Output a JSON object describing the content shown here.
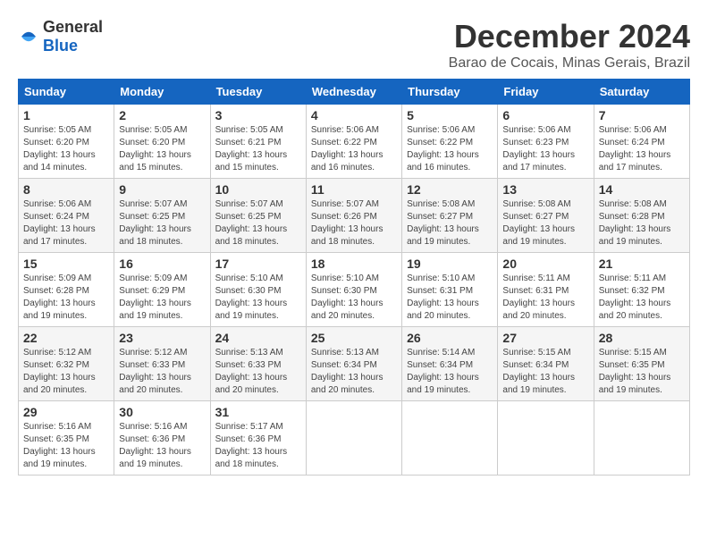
{
  "header": {
    "logo_general": "General",
    "logo_blue": "Blue",
    "month": "December 2024",
    "location": "Barao de Cocais, Minas Gerais, Brazil"
  },
  "days_of_week": [
    "Sunday",
    "Monday",
    "Tuesday",
    "Wednesday",
    "Thursday",
    "Friday",
    "Saturday"
  ],
  "weeks": [
    [
      {
        "day": "1",
        "sunrise": "5:05 AM",
        "sunset": "6:20 PM",
        "daylight": "13 hours and 14 minutes."
      },
      {
        "day": "2",
        "sunrise": "5:05 AM",
        "sunset": "6:20 PM",
        "daylight": "13 hours and 15 minutes."
      },
      {
        "day": "3",
        "sunrise": "5:05 AM",
        "sunset": "6:21 PM",
        "daylight": "13 hours and 15 minutes."
      },
      {
        "day": "4",
        "sunrise": "5:06 AM",
        "sunset": "6:22 PM",
        "daylight": "13 hours and 16 minutes."
      },
      {
        "day": "5",
        "sunrise": "5:06 AM",
        "sunset": "6:22 PM",
        "daylight": "13 hours and 16 minutes."
      },
      {
        "day": "6",
        "sunrise": "5:06 AM",
        "sunset": "6:23 PM",
        "daylight": "13 hours and 17 minutes."
      },
      {
        "day": "7",
        "sunrise": "5:06 AM",
        "sunset": "6:24 PM",
        "daylight": "13 hours and 17 minutes."
      }
    ],
    [
      {
        "day": "8",
        "sunrise": "5:06 AM",
        "sunset": "6:24 PM",
        "daylight": "13 hours and 17 minutes."
      },
      {
        "day": "9",
        "sunrise": "5:07 AM",
        "sunset": "6:25 PM",
        "daylight": "13 hours and 18 minutes."
      },
      {
        "day": "10",
        "sunrise": "5:07 AM",
        "sunset": "6:25 PM",
        "daylight": "13 hours and 18 minutes."
      },
      {
        "day": "11",
        "sunrise": "5:07 AM",
        "sunset": "6:26 PM",
        "daylight": "13 hours and 18 minutes."
      },
      {
        "day": "12",
        "sunrise": "5:08 AM",
        "sunset": "6:27 PM",
        "daylight": "13 hours and 19 minutes."
      },
      {
        "day": "13",
        "sunrise": "5:08 AM",
        "sunset": "6:27 PM",
        "daylight": "13 hours and 19 minutes."
      },
      {
        "day": "14",
        "sunrise": "5:08 AM",
        "sunset": "6:28 PM",
        "daylight": "13 hours and 19 minutes."
      }
    ],
    [
      {
        "day": "15",
        "sunrise": "5:09 AM",
        "sunset": "6:28 PM",
        "daylight": "13 hours and 19 minutes."
      },
      {
        "day": "16",
        "sunrise": "5:09 AM",
        "sunset": "6:29 PM",
        "daylight": "13 hours and 19 minutes."
      },
      {
        "day": "17",
        "sunrise": "5:10 AM",
        "sunset": "6:30 PM",
        "daylight": "13 hours and 19 minutes."
      },
      {
        "day": "18",
        "sunrise": "5:10 AM",
        "sunset": "6:30 PM",
        "daylight": "13 hours and 20 minutes."
      },
      {
        "day": "19",
        "sunrise": "5:10 AM",
        "sunset": "6:31 PM",
        "daylight": "13 hours and 20 minutes."
      },
      {
        "day": "20",
        "sunrise": "5:11 AM",
        "sunset": "6:31 PM",
        "daylight": "13 hours and 20 minutes."
      },
      {
        "day": "21",
        "sunrise": "5:11 AM",
        "sunset": "6:32 PM",
        "daylight": "13 hours and 20 minutes."
      }
    ],
    [
      {
        "day": "22",
        "sunrise": "5:12 AM",
        "sunset": "6:32 PM",
        "daylight": "13 hours and 20 minutes."
      },
      {
        "day": "23",
        "sunrise": "5:12 AM",
        "sunset": "6:33 PM",
        "daylight": "13 hours and 20 minutes."
      },
      {
        "day": "24",
        "sunrise": "5:13 AM",
        "sunset": "6:33 PM",
        "daylight": "13 hours and 20 minutes."
      },
      {
        "day": "25",
        "sunrise": "5:13 AM",
        "sunset": "6:34 PM",
        "daylight": "13 hours and 20 minutes."
      },
      {
        "day": "26",
        "sunrise": "5:14 AM",
        "sunset": "6:34 PM",
        "daylight": "13 hours and 19 minutes."
      },
      {
        "day": "27",
        "sunrise": "5:15 AM",
        "sunset": "6:34 PM",
        "daylight": "13 hours and 19 minutes."
      },
      {
        "day": "28",
        "sunrise": "5:15 AM",
        "sunset": "6:35 PM",
        "daylight": "13 hours and 19 minutes."
      }
    ],
    [
      {
        "day": "29",
        "sunrise": "5:16 AM",
        "sunset": "6:35 PM",
        "daylight": "13 hours and 19 minutes."
      },
      {
        "day": "30",
        "sunrise": "5:16 AM",
        "sunset": "6:36 PM",
        "daylight": "13 hours and 19 minutes."
      },
      {
        "day": "31",
        "sunrise": "5:17 AM",
        "sunset": "6:36 PM",
        "daylight": "13 hours and 18 minutes."
      },
      null,
      null,
      null,
      null
    ]
  ],
  "labels": {
    "sunrise": "Sunrise:",
    "sunset": "Sunset:",
    "daylight": "Daylight:"
  }
}
